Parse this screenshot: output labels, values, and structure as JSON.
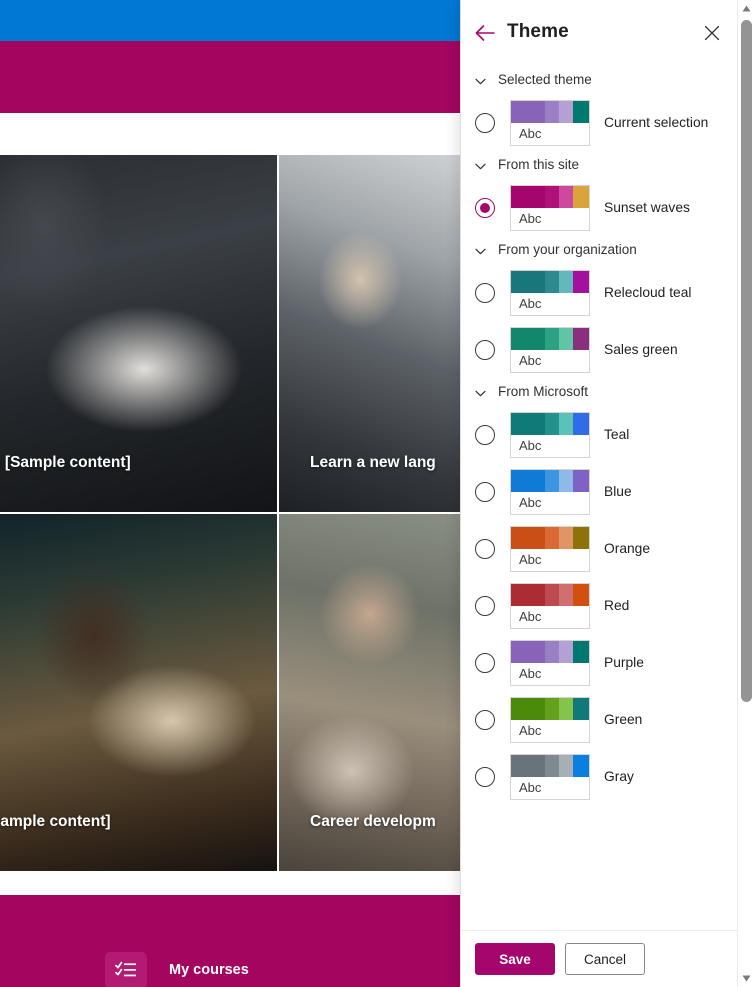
{
  "background_page": {
    "bars": {
      "top_bar_color": "#0078d4",
      "brand_bar_color": "#a4065f",
      "footer_bar_color": "#a4065f"
    },
    "cards": [
      {
        "caption": "s [Sample content]"
      },
      {
        "caption": "Learn a new lang"
      },
      {
        "caption": "Sample content]"
      },
      {
        "caption": "Career developm"
      }
    ],
    "footer_tile": {
      "icon": "checklist-icon",
      "label": "My courses"
    }
  },
  "panel": {
    "title": "Theme",
    "back_icon": "back-arrow-icon",
    "close_icon": "close-icon",
    "accent_color": "#a4066e",
    "sections": [
      {
        "id": "selected-theme",
        "title": "Selected theme",
        "chevron": "chevron-down-icon",
        "options": [
          {
            "id": "current-selection",
            "label": "Current selection",
            "selected": false,
            "sample_text": "Abc",
            "colors": [
              "#8764b8",
              "#9b7fc4",
              "#b5a0d6",
              "#01786f"
            ]
          }
        ]
      },
      {
        "id": "from-this-site",
        "title": "From this site",
        "chevron": "chevron-down-icon",
        "options": [
          {
            "id": "sunset-waves",
            "label": "Sunset waves",
            "selected": true,
            "sample_text": "Abc",
            "colors": [
              "#a4066e",
              "#b01178",
              "#cc4a9e",
              "#dba33b"
            ]
          }
        ]
      },
      {
        "id": "from-your-organization",
        "title": "From your organization",
        "chevron": "chevron-down-icon",
        "options": [
          {
            "id": "relecloud-teal",
            "label": "Relecloud teal",
            "selected": false,
            "sample_text": "Abc",
            "colors": [
              "#19777b",
              "#2d8b90",
              "#64b8bb",
              "#a4109e"
            ]
          },
          {
            "id": "sales-green",
            "label": "Sales green",
            "selected": false,
            "sample_text": "Abc",
            "colors": [
              "#12876c",
              "#2fa183",
              "#62c4a6",
              "#8a2f7e"
            ]
          }
        ]
      },
      {
        "id": "from-microsoft",
        "title": "From Microsoft",
        "chevron": "chevron-down-icon",
        "options": [
          {
            "id": "teal",
            "label": "Teal",
            "selected": false,
            "sample_text": "Abc",
            "colors": [
              "#0f7a78",
              "#23918c",
              "#5cc1b8",
              "#2f6ce5"
            ]
          },
          {
            "id": "blue",
            "label": "Blue",
            "selected": false,
            "sample_text": "Abc",
            "colors": [
              "#0f7bd6",
              "#3d95e0",
              "#8cbbe8",
              "#8062c4"
            ]
          },
          {
            "id": "orange",
            "label": "Orange",
            "selected": false,
            "sample_text": "Abc",
            "colors": [
              "#ca4f16",
              "#d96a36",
              "#e09468",
              "#8c7208"
            ]
          },
          {
            "id": "red",
            "label": "Red",
            "selected": false,
            "sample_text": "Abc",
            "colors": [
              "#ac2c33",
              "#bd4a4e",
              "#cf6f70",
              "#d2500f"
            ]
          },
          {
            "id": "purple",
            "label": "Purple",
            "selected": false,
            "sample_text": "Abc",
            "colors": [
              "#8764b8",
              "#9b7fc4",
              "#b5a0d6",
              "#01786f"
            ]
          },
          {
            "id": "green",
            "label": "Green",
            "selected": false,
            "sample_text": "Abc",
            "colors": [
              "#4b8a0b",
              "#63a01b",
              "#85c44a",
              "#0f7a78"
            ]
          },
          {
            "id": "gray",
            "label": "Gray",
            "selected": false,
            "sample_text": "Abc",
            "colors": [
              "#68737a",
              "#7f8a90",
              "#a5b0b6",
              "#0b7fe0"
            ]
          }
        ]
      }
    ],
    "footer": {
      "save_label": "Save",
      "cancel_label": "Cancel"
    }
  },
  "scrollbar": {
    "up_icon": "scroll-up-arrow-icon",
    "down_icon": "scroll-down-arrow-icon"
  }
}
